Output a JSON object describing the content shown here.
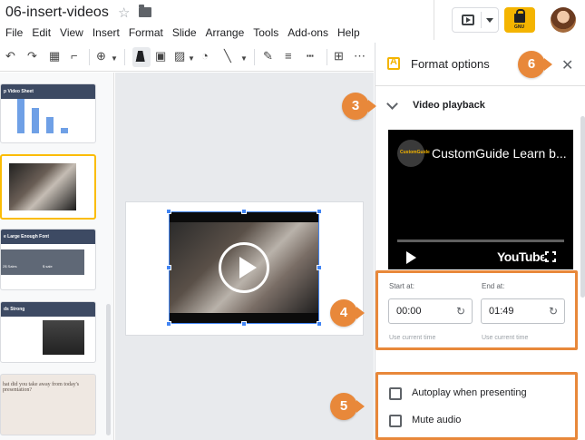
{
  "app": {
    "doc_title": "06-insert-videos",
    "menu": [
      "File",
      "Edit",
      "View",
      "Insert",
      "Format",
      "Slide",
      "Arrange",
      "Tools",
      "Add-ons",
      "Help"
    ]
  },
  "header": {
    "share_label": "GNU"
  },
  "filmstrip": {
    "slides": [
      {
        "title": "p Video Sheet"
      },
      {
        "title": ""
      },
      {
        "title": "e Large Enough Font",
        "rows": [
          [
            "",
            ""
          ],
          [
            "2$ Sales",
            "$ sale"
          ]
        ]
      },
      {
        "title": "ds Strong"
      },
      {
        "title": "hat did you take away from today's presentation?"
      }
    ]
  },
  "panel": {
    "title": "Format options",
    "section_title": "Video playback",
    "video_title": "CustomGuide Learn b...",
    "video_brand": "YouTube",
    "logo_text": "CustomGuide",
    "start_label": "Start at:",
    "end_label": "End at:",
    "start_value": "00:00",
    "end_value": "01:49",
    "use_current": "Use current time",
    "autoplay_label": "Autoplay when presenting",
    "mute_label": "Mute audio"
  },
  "callouts": [
    "3",
    "4",
    "5",
    "6"
  ],
  "colors": {
    "accent_orange": "#e8883a",
    "selection_blue": "#4285f4",
    "share_yellow": "#f4b400"
  }
}
